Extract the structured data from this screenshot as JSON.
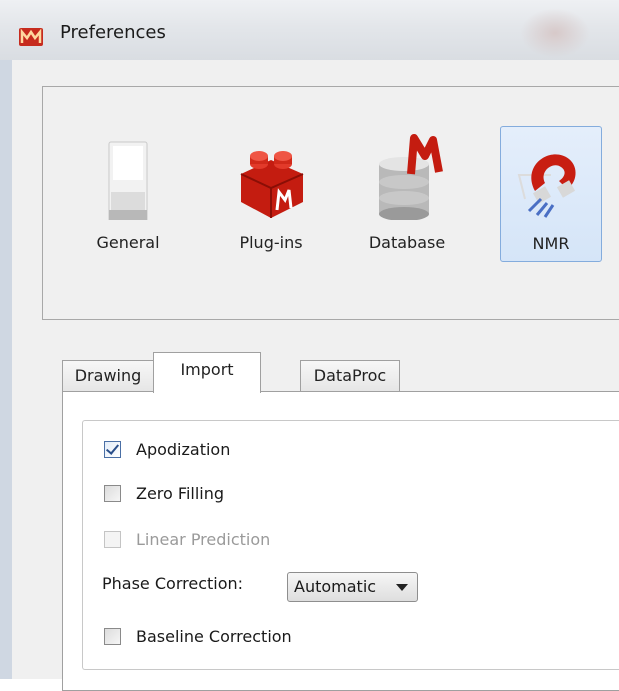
{
  "window": {
    "title": "Preferences"
  },
  "toolbar": {
    "items": [
      {
        "label": "General",
        "icon": "switch-icon",
        "selected": false
      },
      {
        "label": "Plug-ins",
        "icon": "lego-brick-icon",
        "selected": false
      },
      {
        "label": "Database",
        "icon": "database-icon",
        "selected": false
      },
      {
        "label": "NMR",
        "icon": "magnet-icon",
        "selected": true
      }
    ]
  },
  "tabs": [
    {
      "label": "Drawing",
      "active": false
    },
    {
      "label": "Import",
      "active": true
    },
    {
      "label": "DataProc",
      "active": false
    }
  ],
  "import": {
    "apodization": {
      "label": "Apodization",
      "checked": true,
      "enabled": true
    },
    "zero_filling": {
      "label": "Zero Filling",
      "checked": false,
      "enabled": true
    },
    "linear_prediction": {
      "label": "Linear Prediction",
      "checked": false,
      "enabled": false
    },
    "phase_correction": {
      "label": "Phase Correction:",
      "value": "Automatic"
    },
    "baseline_correction": {
      "label": "Baseline Correction",
      "checked": false,
      "enabled": true
    }
  },
  "colors": {
    "selection": "#d5e5f8",
    "brand": "#cc2222"
  }
}
